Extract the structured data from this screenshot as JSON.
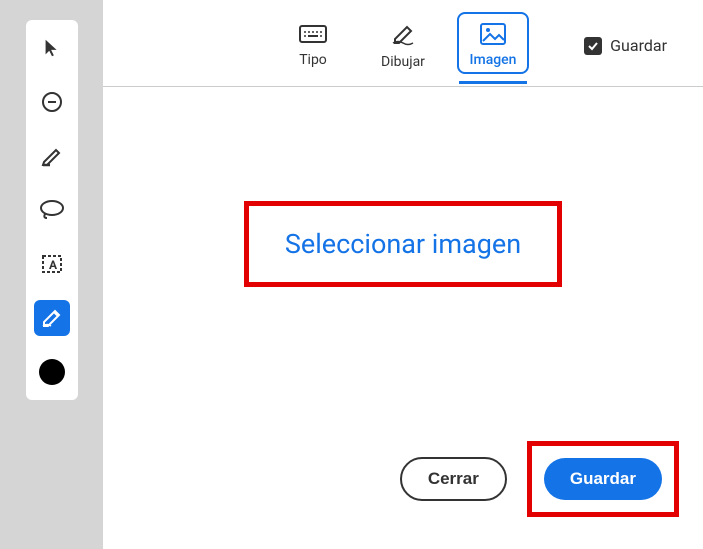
{
  "tabs": {
    "type": "Tipo",
    "draw": "Dibujar",
    "image": "Imagen"
  },
  "saveCheckbox": {
    "label": "Guardar",
    "checked": true
  },
  "content": {
    "selectImage": "Seleccionar imagen"
  },
  "footer": {
    "close": "Cerrar",
    "save": "Guardar"
  },
  "sidebar": {
    "tools": [
      "select",
      "comment",
      "highlight",
      "lasso",
      "text-box",
      "pen"
    ],
    "activeTool": "pen",
    "color": "#000000"
  },
  "colors": {
    "accent": "#1473e6",
    "highlight": "#e20000"
  }
}
